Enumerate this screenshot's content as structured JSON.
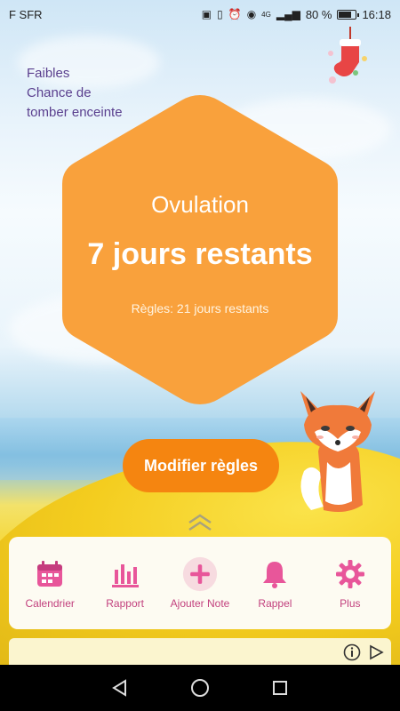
{
  "status_bar": {
    "carrier": "F SFR",
    "network": "4G",
    "battery_percent": "80 %",
    "battery_level": 0.8,
    "time": "16:18"
  },
  "chance": {
    "level": "Faibles",
    "label_line1": "Chance de",
    "label_line2": "tomber enceinte"
  },
  "main_card": {
    "title": "Ovulation",
    "days_remaining": "7 jours restants",
    "subtitle": "Règles: 21 jours restants",
    "color": "#f9a13c"
  },
  "actions": {
    "modify_label": "Modifier règles"
  },
  "tabbar": {
    "items": [
      {
        "label": "Calendrier",
        "icon": "calendar-icon"
      },
      {
        "label": "Rapport",
        "icon": "bar-chart-icon"
      },
      {
        "label": "Ajouter Note",
        "icon": "plus-icon"
      },
      {
        "label": "Rappel",
        "icon": "bell-icon"
      },
      {
        "label": "Plus",
        "icon": "gear-icon"
      }
    ]
  },
  "colors": {
    "accent": "#f58510",
    "tab_icon": "#e8569a",
    "chance_text": "#5a3f8e"
  }
}
